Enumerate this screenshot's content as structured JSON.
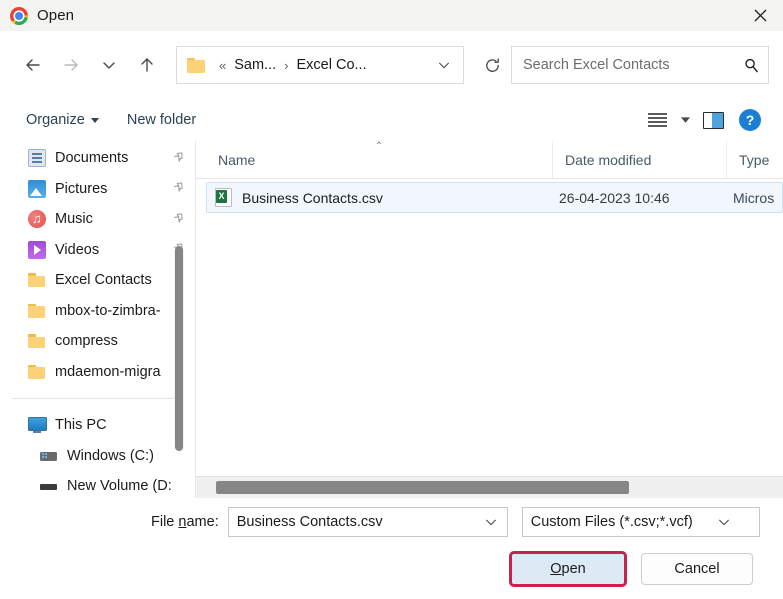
{
  "window": {
    "title": "Open",
    "app_icon": "chrome-logo-icon",
    "close_label": "✕"
  },
  "nav": {
    "back_icon": "arrow-left-icon",
    "forward_icon": "arrow-right-icon",
    "recent_icon": "chevron-down-icon",
    "up_icon": "arrow-up-icon",
    "breadcrumb": {
      "folder_icon": "folder-icon",
      "overflow": "«",
      "items": [
        "Sam...",
        "Excel Co..."
      ],
      "separator": "›",
      "caret_icon": "chevron-down-icon"
    },
    "search": {
      "placeholder": "Search Excel Contacts",
      "value": "",
      "icon": "search-icon"
    },
    "refresh_icon": "refresh-icon"
  },
  "toolbar": {
    "organize_label": "Organize",
    "new_folder_label": "New folder",
    "view_icon": "view-list-icon",
    "view_caret_icon": "caret-down-icon",
    "preview_pane_icon": "preview-pane-icon",
    "help_icon": "help-icon",
    "help_label": "?"
  },
  "sidebar": {
    "items": [
      {
        "label": "Documents",
        "icon": "documents-icon",
        "pinned": true,
        "indent": 1
      },
      {
        "label": "Pictures",
        "icon": "pictures-icon",
        "pinned": true,
        "indent": 1
      },
      {
        "label": "Music",
        "icon": "music-icon",
        "pinned": true,
        "indent": 1
      },
      {
        "label": "Videos",
        "icon": "videos-icon",
        "pinned": true,
        "indent": 1
      },
      {
        "label": "Excel Contacts",
        "icon": "folder-icon",
        "pinned": false,
        "indent": 1
      },
      {
        "label": "mbox-to-zimbra-",
        "icon": "folder-icon",
        "pinned": false,
        "indent": 1
      },
      {
        "label": "compress",
        "icon": "folder-icon",
        "pinned": false,
        "indent": 1
      },
      {
        "label": "mdaemon-migra",
        "icon": "folder-icon",
        "pinned": false,
        "indent": 1
      }
    ],
    "items2": [
      {
        "label": "This PC",
        "icon": "this-pc-icon",
        "indent": 1
      },
      {
        "label": "Windows (C:)",
        "icon": "hard-drive-icon",
        "indent": 2
      },
      {
        "label": "New Volume (D:",
        "icon": "hard-drive-icon",
        "indent": 2
      }
    ],
    "pin_icon": "pin-icon",
    "scrollbar": "vertical-scrollbar"
  },
  "filelist": {
    "columns": [
      "Name",
      "Date modified",
      "Type"
    ],
    "sort_caret": "⌃",
    "rows": [
      {
        "name": "Business Contacts.csv",
        "date": "26-04-2023 10:46",
        "type": "Micros",
        "icon": "csv-file-icon",
        "selected": true
      }
    ],
    "hscrollbar": "horizontal-scrollbar"
  },
  "footer": {
    "filename_label_pre": "File ",
    "filename_label_accel": "n",
    "filename_label_post": "ame:",
    "filename_value": "Business Contacts.csv",
    "filename_caret_icon": "chevron-down-icon",
    "filetype_value": "Custom Files (*.csv;*.vcf)",
    "filetype_caret_icon": "chevron-down-icon",
    "open_pre": "",
    "open_accel": "O",
    "open_post": "pen",
    "cancel_label": "Cancel",
    "highlight_color": "#c9224c"
  }
}
